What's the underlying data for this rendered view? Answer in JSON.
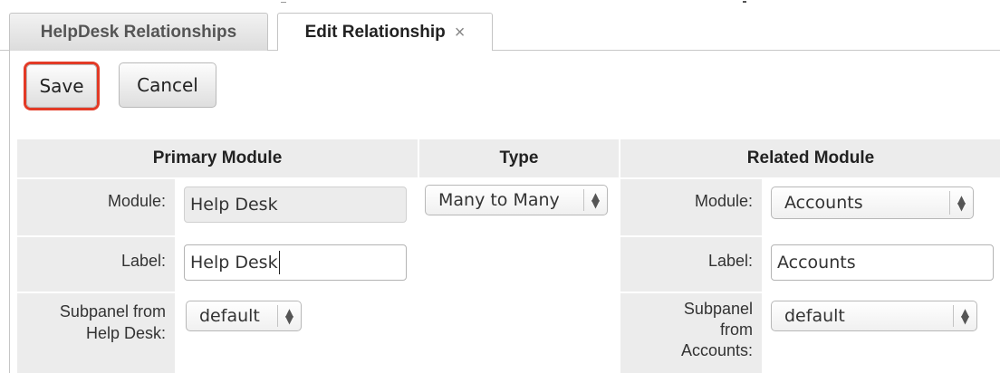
{
  "tabs": [
    {
      "label": "HelpDesk Relationships",
      "active": false
    },
    {
      "label": "Edit Relationship",
      "active": true,
      "close_glyph": "×"
    }
  ],
  "toolbar": {
    "save_label": "Save",
    "cancel_label": "Cancel",
    "highlight_color": "#e33a26"
  },
  "headers": {
    "primary": "Primary Module",
    "type": "Type",
    "related": "Related Module"
  },
  "primary": {
    "module_label": "Module:",
    "module_value": "Help Desk",
    "label_label": "Label:",
    "label_value": "Help Desk",
    "subpanel_label_line1": "Subpanel from",
    "subpanel_label_line2": "Help Desk:",
    "subpanel_value": "default"
  },
  "type": {
    "value": "Many to Many"
  },
  "related": {
    "module_label": "Module:",
    "module_value": "Accounts",
    "label_label": "Label:",
    "label_value": "Accounts",
    "subpanel_label_line1": "Subpanel",
    "subpanel_label_line2": "from",
    "subpanel_label_line3": "Accounts:",
    "subpanel_value": "default"
  },
  "icons": {
    "select_arrows": "updown-arrows-icon",
    "close": "close-icon"
  }
}
